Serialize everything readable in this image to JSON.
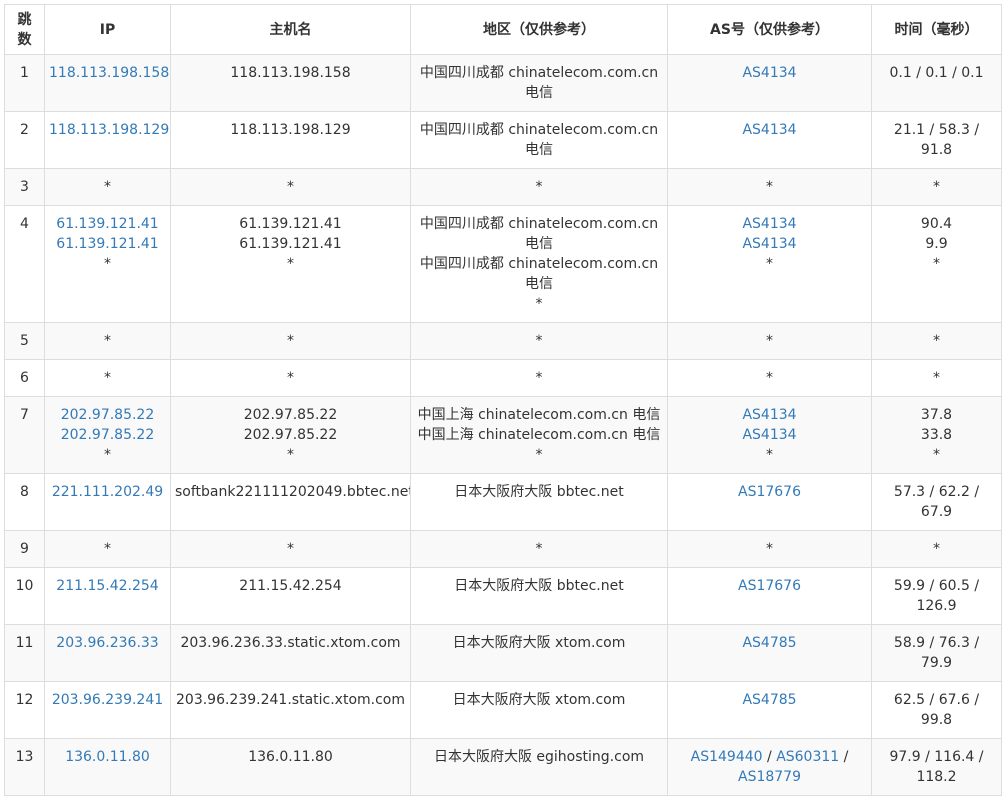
{
  "headers": {
    "hop": "跳数",
    "ip": "IP",
    "host": "主机名",
    "region": "地区（仅供参考）",
    "as": "AS号（仅供参考）",
    "time": "时间（毫秒）"
  },
  "rows": [
    {
      "hop": "1",
      "ip": [
        "118.113.198.158"
      ],
      "host": [
        "118.113.198.158"
      ],
      "region": [
        "中国四川成都 chinatelecom.com.cn",
        "电信"
      ],
      "as": [
        [
          "AS4134"
        ]
      ],
      "time": [
        "0.1 / 0.1 / 0.1"
      ]
    },
    {
      "hop": "2",
      "ip": [
        "118.113.198.129"
      ],
      "host": [
        "118.113.198.129"
      ],
      "region": [
        "中国四川成都 chinatelecom.com.cn",
        "电信"
      ],
      "as": [
        [
          "AS4134"
        ]
      ],
      "time": [
        "21.1 / 58.3 /",
        "91.8"
      ]
    },
    {
      "hop": "3",
      "ip": [
        "*"
      ],
      "host": [
        "*"
      ],
      "region": [
        "*"
      ],
      "as": [
        [
          "*"
        ]
      ],
      "time": [
        "*"
      ]
    },
    {
      "hop": "4",
      "ip": [
        "61.139.121.41",
        "61.139.121.41",
        "*"
      ],
      "host": [
        "61.139.121.41",
        "61.139.121.41",
        "*"
      ],
      "region": [
        "中国四川成都 chinatelecom.com.cn",
        "电信",
        "中国四川成都 chinatelecom.com.cn",
        "电信",
        "*"
      ],
      "as": [
        [
          "AS4134"
        ],
        [
          "AS4134"
        ],
        [
          "*"
        ]
      ],
      "time": [
        "90.4",
        "9.9",
        "*"
      ]
    },
    {
      "hop": "5",
      "ip": [
        "*"
      ],
      "host": [
        "*"
      ],
      "region": [
        "*"
      ],
      "as": [
        [
          "*"
        ]
      ],
      "time": [
        "*"
      ]
    },
    {
      "hop": "6",
      "ip": [
        "*"
      ],
      "host": [
        "*"
      ],
      "region": [
        "*"
      ],
      "as": [
        [
          "*"
        ]
      ],
      "time": [
        "*"
      ]
    },
    {
      "hop": "7",
      "ip": [
        "202.97.85.22",
        "202.97.85.22",
        "*"
      ],
      "host": [
        "202.97.85.22",
        "202.97.85.22",
        "*"
      ],
      "region": [
        "中国上海 chinatelecom.com.cn 电信",
        "中国上海 chinatelecom.com.cn 电信",
        "*"
      ],
      "as": [
        [
          "AS4134"
        ],
        [
          "AS4134"
        ],
        [
          "*"
        ]
      ],
      "time": [
        "37.8",
        "33.8",
        "*"
      ]
    },
    {
      "hop": "8",
      "ip": [
        "221.111.202.49"
      ],
      "host": [
        "softbank221111202049.bbtec.net"
      ],
      "region": [
        "日本大阪府大阪 bbtec.net"
      ],
      "as": [
        [
          "AS17676"
        ]
      ],
      "time": [
        "57.3 / 62.2 /",
        "67.9"
      ]
    },
    {
      "hop": "9",
      "ip": [
        "*"
      ],
      "host": [
        "*"
      ],
      "region": [
        "*"
      ],
      "as": [
        [
          "*"
        ]
      ],
      "time": [
        "*"
      ]
    },
    {
      "hop": "10",
      "ip": [
        "211.15.42.254"
      ],
      "host": [
        "211.15.42.254"
      ],
      "region": [
        "日本大阪府大阪 bbtec.net"
      ],
      "as": [
        [
          "AS17676"
        ]
      ],
      "time": [
        "59.9 / 60.5 /",
        "126.9"
      ]
    },
    {
      "hop": "11",
      "ip": [
        "203.96.236.33"
      ],
      "host": [
        "203.96.236.33.static.xtom.com"
      ],
      "region": [
        "日本大阪府大阪 xtom.com"
      ],
      "as": [
        [
          "AS4785"
        ]
      ],
      "time": [
        "58.9 / 76.3 /",
        "79.9"
      ]
    },
    {
      "hop": "12",
      "ip": [
        "203.96.239.241"
      ],
      "host": [
        "203.96.239.241.static.xtom.com"
      ],
      "region": [
        "日本大阪府大阪 xtom.com"
      ],
      "as": [
        [
          "AS4785"
        ]
      ],
      "time": [
        "62.5 / 67.6 /",
        "99.8"
      ]
    },
    {
      "hop": "13",
      "ip": [
        "136.0.11.80"
      ],
      "host": [
        "136.0.11.80"
      ],
      "region": [
        "日本大阪府大阪 egihosting.com"
      ],
      "as": [
        [
          "AS149440",
          " / ",
          "AS60311",
          " /"
        ],
        [
          "AS18779"
        ]
      ],
      "time": [
        "97.9 / 116.4 /",
        "118.2"
      ]
    }
  ],
  "colors": {
    "link": "#337ab7",
    "border": "#dddddd",
    "stripe": "#f9f9f9",
    "text": "#333333"
  }
}
